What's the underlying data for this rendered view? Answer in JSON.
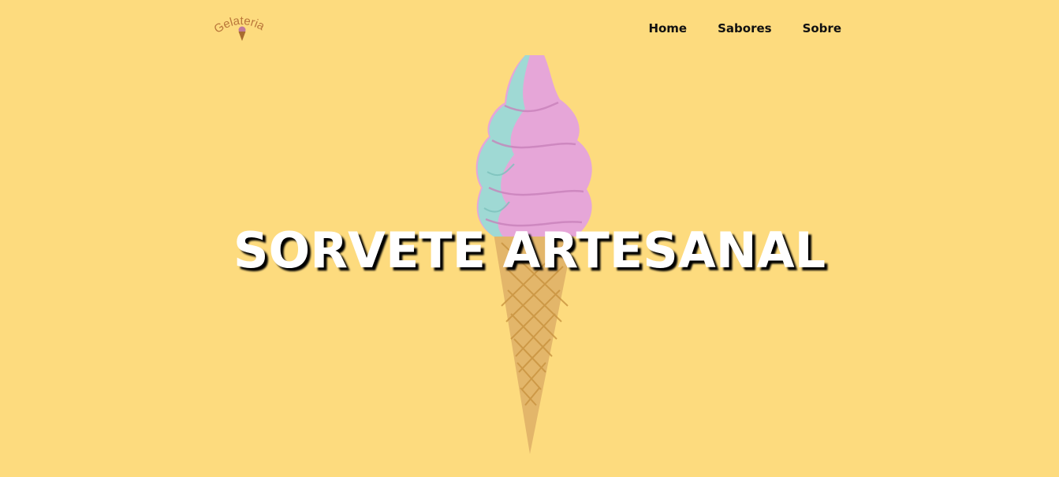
{
  "header": {
    "logo_text": "Gelateria",
    "nav": [
      {
        "label": "Home"
      },
      {
        "label": "Sabores"
      },
      {
        "label": "Sobre"
      }
    ]
  },
  "hero": {
    "title": "SORVETE ARTESANAL",
    "image": "soft-serve-ice-cream-cone"
  },
  "colors": {
    "background": "#fddb7e",
    "title": "#ffffff",
    "nav_text": "#111111",
    "logo": "#b9763a",
    "cream_pink": "#e7a3d6",
    "cream_teal": "#9fd9d4",
    "cone": "#e3b66a"
  }
}
